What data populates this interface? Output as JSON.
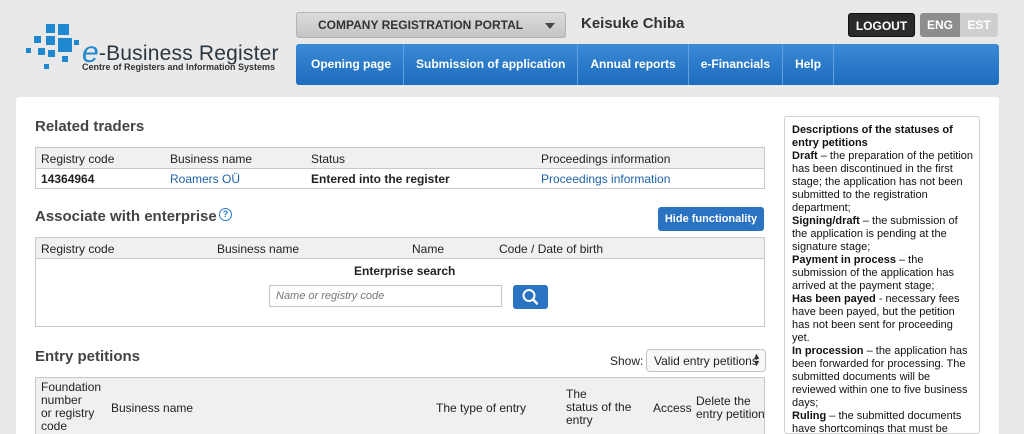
{
  "header": {
    "logo": {
      "title_e": "e",
      "title_rest": "-Business Register",
      "subtitle": "Centre of Registers and Information Systems"
    },
    "portal_select": "COMPANY REGISTRATION PORTAL",
    "user_name": "Keisuke Chiba",
    "logout": "LOGOUT",
    "languages": [
      "ENG",
      "EST"
    ],
    "nav": [
      "Opening page",
      "Submission of application",
      "Annual reports",
      "e-Financials",
      "Help"
    ]
  },
  "related_traders": {
    "title": "Related traders",
    "columns": [
      "Registry code",
      "Business name",
      "Status",
      "Proceedings information"
    ],
    "row": {
      "registry_code": "14364964",
      "business_name": "Roamers OÜ",
      "status": "Entered into the register",
      "proceedings": "Proceedings information"
    }
  },
  "associate": {
    "title": "Associate with enterprise",
    "help_glyph": "?",
    "hide_button": "Hide functionality",
    "columns": [
      "Registry code",
      "Business name",
      "Name",
      "Code / Date of birth"
    ],
    "search_title": "Enterprise search",
    "search_placeholder": "Name or registry code"
  },
  "entry_petitions": {
    "title": "Entry petitions",
    "show_label": "Show:",
    "show_value": "Valid entry petitions",
    "columns": {
      "foundation": [
        "Foundation",
        "number",
        "or registry",
        "code"
      ],
      "business_name": "Business name",
      "entry_type": "The type of entry",
      "status": [
        "The",
        "status of the",
        "entry"
      ],
      "access": "Access",
      "delete": [
        "Delete the",
        "entry petition"
      ]
    }
  },
  "descriptions": {
    "title": "Descriptions of the statuses of entry petitions",
    "items": [
      {
        "term": "Draft",
        "text": " – the preparation of the petition has been discontinued in the first stage; the application has not been submitted to the registration department;"
      },
      {
        "term": "Signing/draft",
        "text": " – the submission of the application is pending at the signature stage;"
      },
      {
        "term": "Payment in process",
        "text": " – the submission of the application has arrived at the payment stage;"
      },
      {
        "term": "Has been payed",
        "text": " - necessary fees have been payed, but the petition has not been sent for proceeding yet."
      },
      {
        "term": "In procession",
        "text": " – the application has been forwarded for processing. The submitted documents will be reviewed within one to five business days;"
      },
      {
        "term": "Ruling",
        "text": " – the submitted documents have shortcomings that must be"
      }
    ]
  },
  "colors": {
    "nav_blue": "#2a7bc7",
    "link_blue": "#1f62a8",
    "dark_button": "#2b2b2b",
    "page_bg": "#e9e9e9"
  }
}
